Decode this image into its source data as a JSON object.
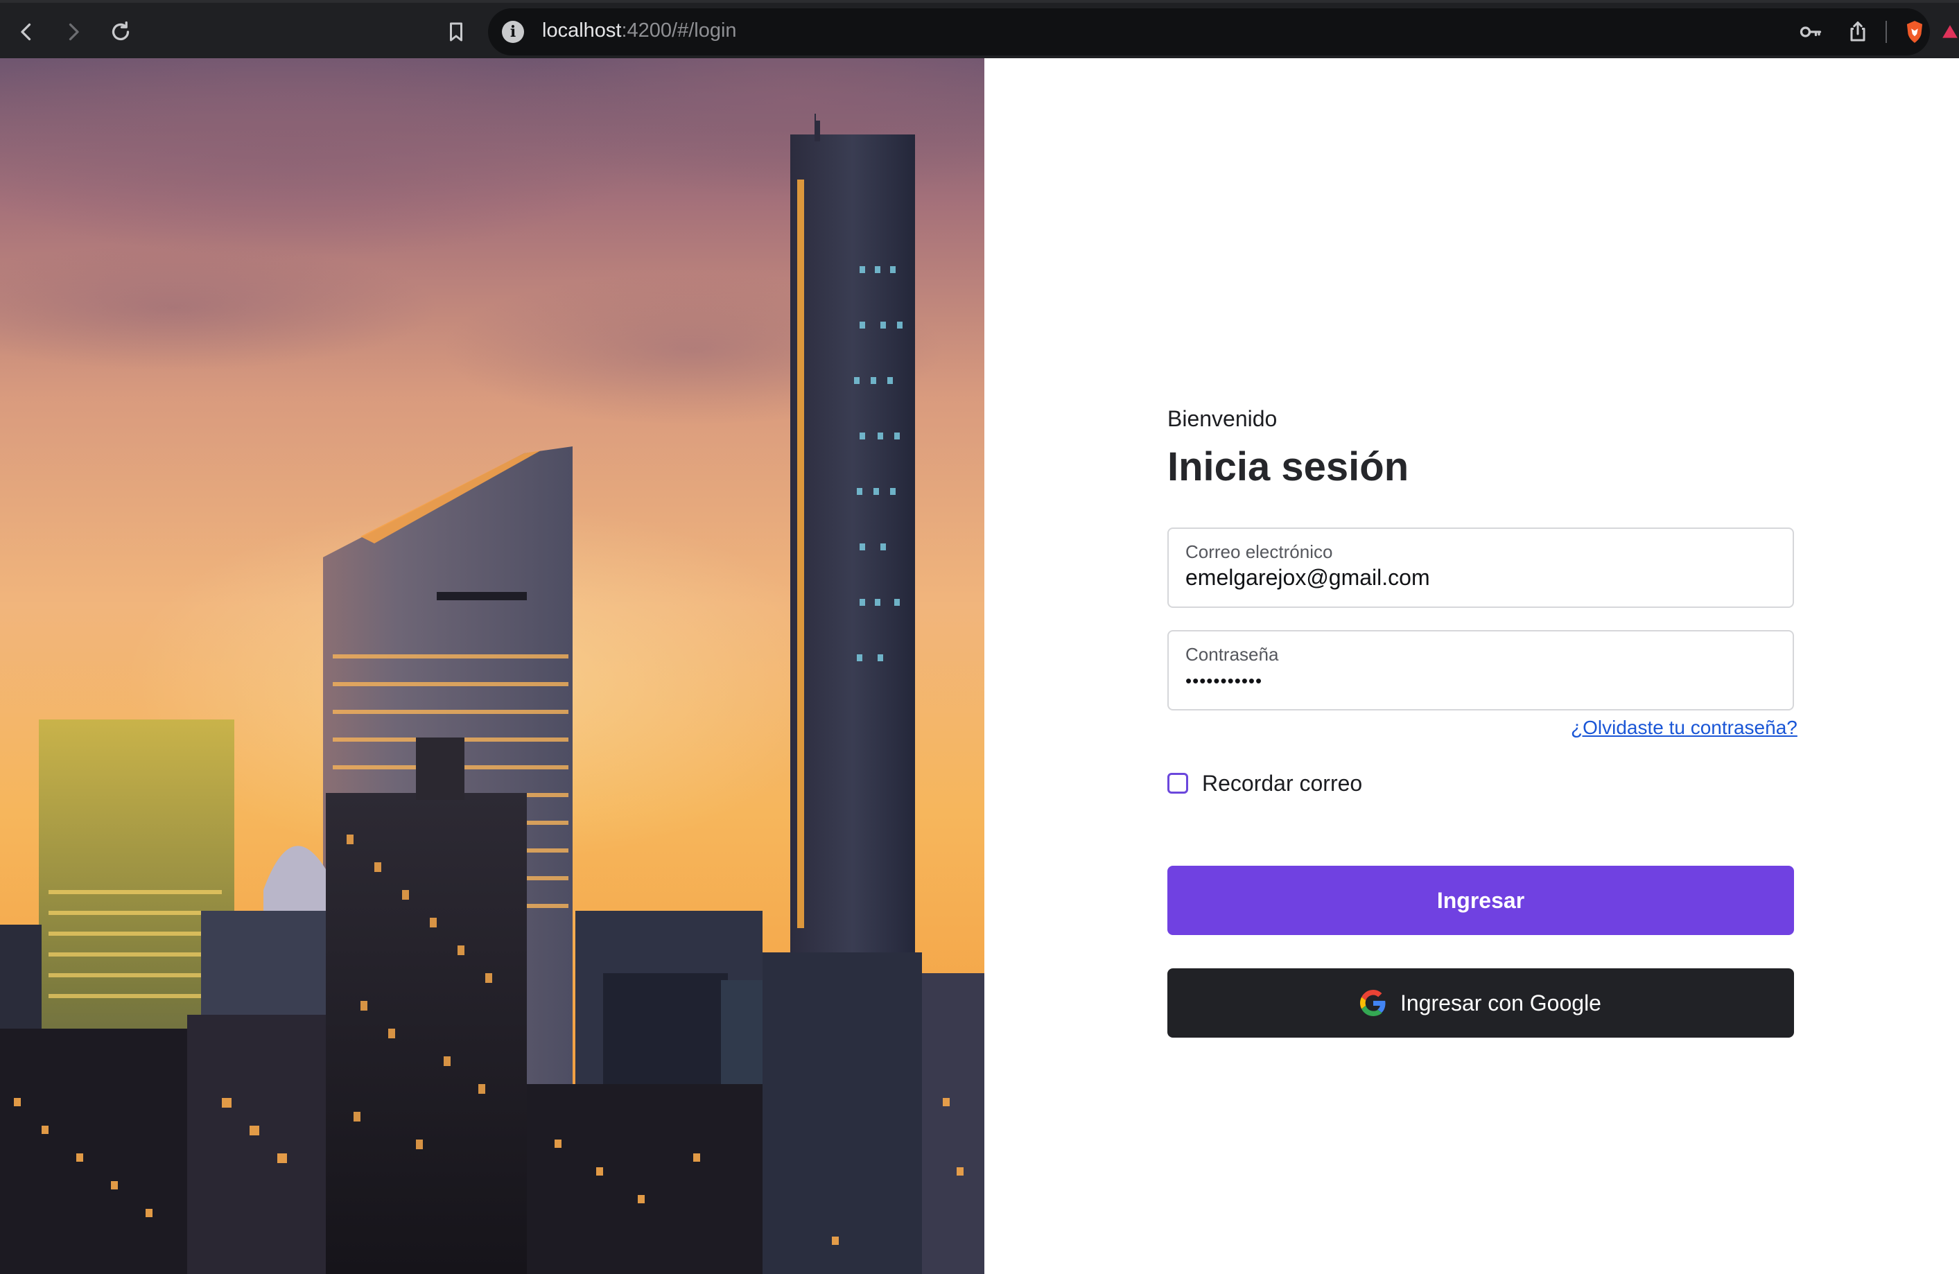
{
  "browser": {
    "url_host": "localhost",
    "url_path": ":4200/#/login"
  },
  "login": {
    "greeting": "Bienvenido",
    "heading": "Inicia sesión",
    "email": {
      "label": "Correo electrónico",
      "value": "emelgarejox@gmail.com"
    },
    "password": {
      "label": "Contraseña",
      "masked_value": "•••••••••••"
    },
    "forgot_link": "¿Olvidaste tu contraseña?",
    "remember_label": "Recordar correo",
    "remember_checked": false,
    "submit_label": "Ingresar",
    "google_label": "Ingresar con Google"
  },
  "colors": {
    "primary": "#7041e1",
    "google_button": "#212226",
    "link": "#1a56d6"
  },
  "icons": [
    "back-icon",
    "forward-icon",
    "reload-icon",
    "bookmark-icon",
    "site-info-icon",
    "key-icon",
    "share-icon",
    "brave-shield-icon",
    "google-icon"
  ]
}
